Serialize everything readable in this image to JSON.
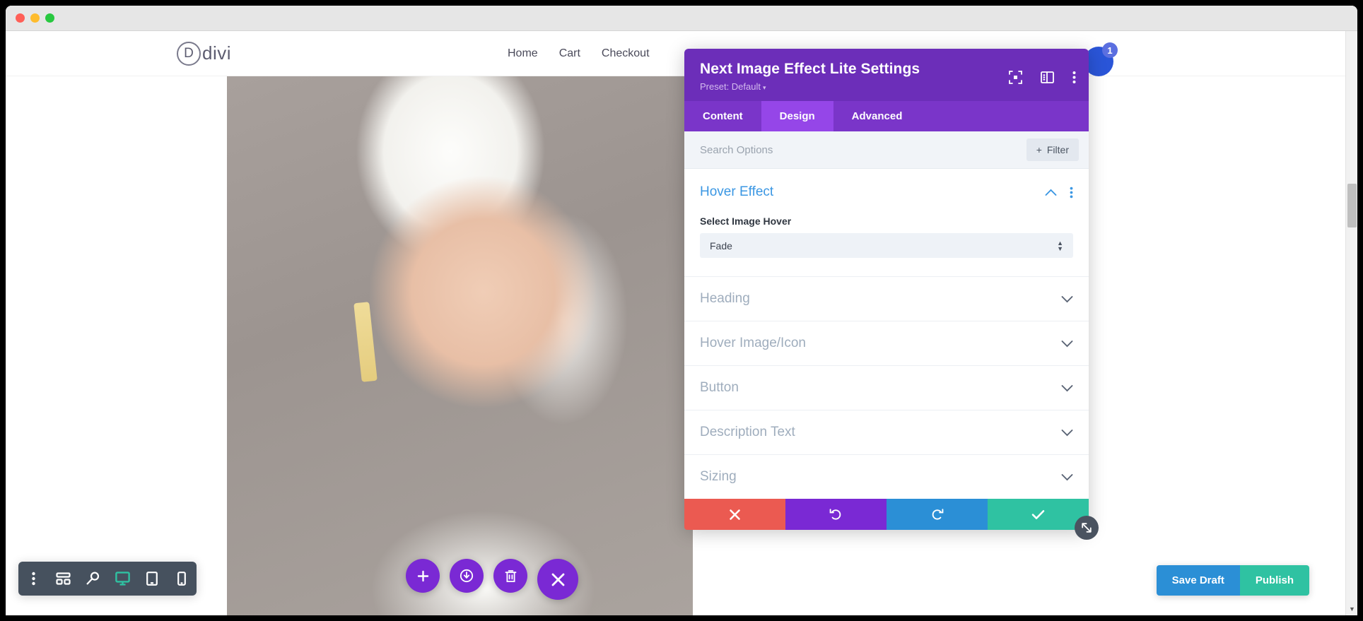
{
  "browser": {
    "traffic_lights": [
      "close",
      "minimize",
      "maximize"
    ]
  },
  "site": {
    "logo_mark": "D",
    "logo_word": "divi",
    "nav": [
      {
        "label": "Home"
      },
      {
        "label": "Cart"
      },
      {
        "label": "Checkout"
      }
    ]
  },
  "notification": {
    "count": "1"
  },
  "tool_dock": {
    "items": [
      {
        "name": "more-options-icon",
        "active": false
      },
      {
        "name": "wireframe-view-icon",
        "active": false
      },
      {
        "name": "zoom-out-view-icon",
        "active": false
      },
      {
        "name": "desktop-view-icon",
        "active": true
      },
      {
        "name": "tablet-view-icon",
        "active": false
      },
      {
        "name": "phone-view-icon",
        "active": false
      }
    ]
  },
  "floating_buttons": [
    {
      "name": "add-module-button",
      "icon": "plus"
    },
    {
      "name": "save-to-library-button",
      "icon": "power-download"
    },
    {
      "name": "delete-button",
      "icon": "trash"
    },
    {
      "name": "close-builder-button",
      "icon": "close"
    }
  ],
  "modal": {
    "title": "Next Image Effect Lite Settings",
    "preset_label": "Preset: Default",
    "preset_caret": "▾",
    "head_icons": [
      {
        "name": "focus-target-icon"
      },
      {
        "name": "panel-layout-icon"
      },
      {
        "name": "more-vertical-icon"
      }
    ],
    "tabs": [
      {
        "label": "Content",
        "active": false
      },
      {
        "label": "Design",
        "active": true
      },
      {
        "label": "Advanced",
        "active": false
      }
    ],
    "search": {
      "placeholder": "Search Options",
      "value": ""
    },
    "filter_button": {
      "label": "Filter",
      "plus": "+"
    },
    "open_section": {
      "title": "Hover Effect",
      "field_label": "Select Image Hover",
      "select_value": "Fade",
      "select_options": [
        "Fade"
      ]
    },
    "sections": [
      {
        "label": "Heading"
      },
      {
        "label": "Hover Image/Icon"
      },
      {
        "label": "Button"
      },
      {
        "label": "Description Text"
      },
      {
        "label": "Sizing"
      }
    ],
    "actions": [
      {
        "name": "cancel-button",
        "icon": "close",
        "color": "#eb5a51"
      },
      {
        "name": "undo-button",
        "icon": "undo",
        "color": "#7a29d4"
      },
      {
        "name": "redo-button",
        "icon": "redo",
        "color": "#2b8fd6"
      },
      {
        "name": "save-changes-button",
        "icon": "check",
        "color": "#2fc2a2"
      }
    ],
    "resize_handle": "resize-handle-icon"
  },
  "publish_bar": {
    "save_draft": "Save Draft",
    "publish": "Publish"
  },
  "colors": {
    "modal_header": "#6c2eb9",
    "tab_bar": "#7a35c9",
    "tab_active": "#9546e8",
    "accent_blue": "#3b97e3",
    "danger": "#eb5a51",
    "success": "#2fc2a2",
    "info": "#2b8fd6",
    "purple": "#7a29d4",
    "dock": "#46515e"
  }
}
